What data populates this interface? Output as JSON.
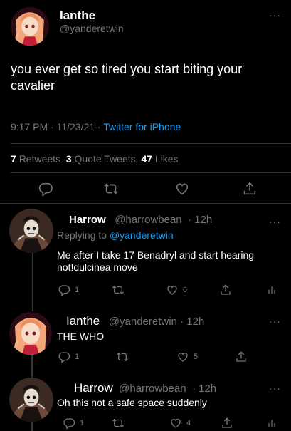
{
  "main_tweet": {
    "author_name": "Ianthe",
    "author_handle": "@yanderetwin",
    "text_line1": "you ever get so tired you start biting your",
    "text_line2": "cavalier",
    "timestamp": "9:17 PM · 11/23/21 ·",
    "source": "Twitter for iPhone",
    "retweets_count": "7",
    "retweets_label": "Retweets",
    "quotes_count": "3",
    "quotes_label": "Quote Tweets",
    "likes_count": "47",
    "likes_label": "Likes"
  },
  "replies": [
    {
      "author_name": "Harrow",
      "author_handle": "@harrowbean",
      "time": "· 12h",
      "replying_prefix": "Replying to",
      "replying_to": "@yanderetwin",
      "text_line1": "Me after I take 17 Benadryl and start hearing",
      "text_line2": "not!dulcinea move",
      "reply_count": "1",
      "retweet_count": "",
      "like_count": "6"
    },
    {
      "author_name": "Ianthe",
      "author_handle": "@yanderetwin",
      "time": "· 12h",
      "text_line1": "THE WHO",
      "reply_count": "1",
      "retweet_count": "",
      "like_count": "5"
    },
    {
      "author_name": "Harrow",
      "author_handle": "@harrowbean",
      "time": "· 12h",
      "text_line1": "Oh this not a safe space suddenly",
      "reply_count": "1",
      "retweet_count": "",
      "like_count": "4"
    }
  ],
  "more_icon": "···",
  "colors": {
    "background": "#000000",
    "text": "#e7e9ea",
    "muted": "#71767b",
    "link": "#1d9bf0",
    "divider": "#2f3336"
  }
}
